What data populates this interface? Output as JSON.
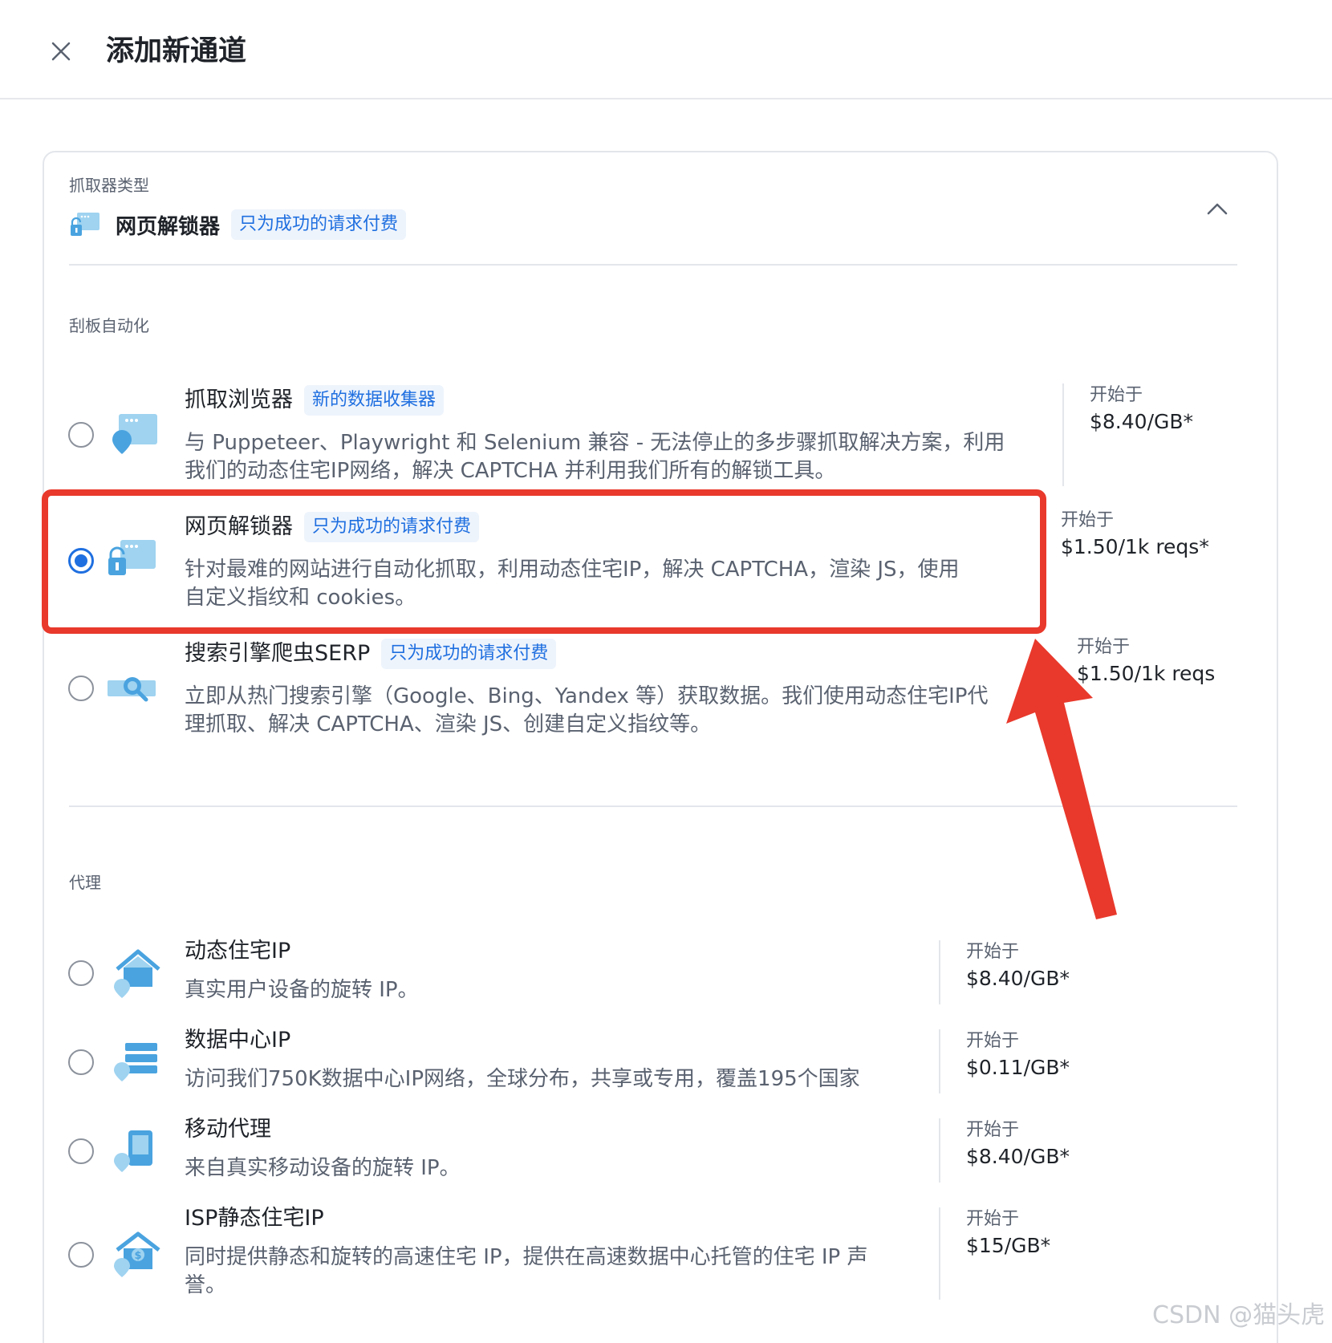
{
  "header": {
    "title": "添加新通道",
    "close_icon": "close-icon"
  },
  "selector": {
    "label": "抓取器类型",
    "selected_name": "网页解锁器",
    "selected_tag": "只为成功的请求付费",
    "icon": "unlocker-icon",
    "toggle_icon": "chevron-up-icon"
  },
  "sections": {
    "automation": "刮板自动化",
    "proxy": "代理"
  },
  "automation_options": [
    {
      "title": "抓取浏览器",
      "tag": "新的数据收集器",
      "desc_line1": "与 Puppeteer、Playwright 和 Selenium 兼容 - 无法停止的多步骤抓取解决方案，利用",
      "desc_line2": "我们的动态住宅IP网络，解决 CAPTCHA 并利用我们所有的解锁工具。",
      "price_label": "开始于",
      "price": "$8.40/GB*",
      "selected": false,
      "icon": "browser-icon"
    },
    {
      "title": "网页解锁器",
      "tag": "只为成功的请求付费",
      "desc_line1": "针对最难的网站进行自动化抓取，利用动态住宅IP，解决 CAPTCHA，渲染 JS，使用",
      "desc_line2": "自定义指纹和 cookies。",
      "price_label": "开始于",
      "price": "$1.50/1k reqs*",
      "selected": true,
      "icon": "unlocker-icon"
    },
    {
      "title": "搜索引擎爬虫SERP",
      "tag": "只为成功的请求付费",
      "desc_line1": "立即从热门搜索引擎（Google、Bing、Yandex 等）获取数据。我们使用动态住宅IP代",
      "desc_line2": "理抓取、解决 CAPTCHA、渲染 JS、创建自定义指纹等。",
      "price_label": "开始于",
      "price": "$1.50/1k reqs",
      "selected": false,
      "icon": "search-icon"
    }
  ],
  "proxy_options": [
    {
      "title": "动态住宅IP",
      "desc_line1": "真实用户设备的旋转 IP。",
      "price_label": "开始于",
      "price": "$8.40/GB*",
      "icon": "residential-icon"
    },
    {
      "title": "数据中心IP",
      "desc_line1": "访问我们750K数据中心IP网络，全球分布，共享或专用，覆盖195个国家",
      "price_label": "开始于",
      "price": "$0.11/GB*",
      "icon": "datacenter-icon"
    },
    {
      "title": "移动代理",
      "desc_line1": "来自真实移动设备的旋转 IP。",
      "price_label": "开始于",
      "price": "$8.40/GB*",
      "icon": "mobile-icon"
    },
    {
      "title": "ISP静态住宅IP",
      "desc_line1": "同时提供静态和旋转的高速住宅 IP，提供在高速数据中心托管的住宅 IP 声",
      "desc_line2": "誉。",
      "price_label": "开始于",
      "price": "$15/GB*",
      "icon": "isp-icon"
    }
  ],
  "watermark": "CSDN @猫头虎",
  "colors": {
    "accent": "#1f6fe0",
    "highlight": "#e8392c",
    "icon_blue": "#4aa3df"
  }
}
